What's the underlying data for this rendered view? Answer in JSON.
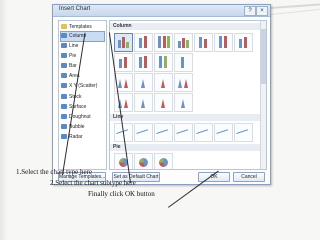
{
  "dialog": {
    "title": "Insert Chart",
    "help_glyph": "?",
    "close_glyph": "×"
  },
  "categories": [
    {
      "label": "Templates",
      "icon": "folder-icon"
    },
    {
      "label": "Column",
      "icon": "column-chart-icon"
    },
    {
      "label": "Line",
      "icon": "line-chart-icon"
    },
    {
      "label": "Pie",
      "icon": "pie-chart-icon"
    },
    {
      "label": "Bar",
      "icon": "bar-chart-icon"
    },
    {
      "label": "Area",
      "icon": "area-chart-icon"
    },
    {
      "label": "X Y (Scatter)",
      "icon": "scatter-chart-icon"
    },
    {
      "label": "Stock",
      "icon": "stock-chart-icon"
    },
    {
      "label": "Surface",
      "icon": "surface-chart-icon"
    },
    {
      "label": "Doughnut",
      "icon": "doughnut-chart-icon"
    },
    {
      "label": "Bubble",
      "icon": "bubble-chart-icon"
    },
    {
      "label": "Radar",
      "icon": "radar-chart-icon"
    }
  ],
  "selected_category": "Column",
  "sections": {
    "column": "Column",
    "line": "Line",
    "pie": "Pie"
  },
  "buttons": {
    "manage": "Manage Templates...",
    "set_default": "Set as Default Chart",
    "ok": "OK",
    "cancel": "Cancel"
  },
  "instructions": {
    "step1": "1.Select the chart type here",
    "step2": "2.Select the chart subtype here",
    "step3": "Finally click OK button"
  },
  "colors": {
    "accent": "#5a8ac6",
    "selection": "#c9dcf3"
  }
}
